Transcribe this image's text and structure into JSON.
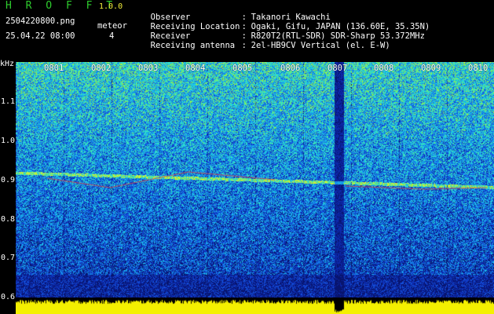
{
  "header": {
    "app_title": "H R O F F T",
    "version": "1.0.0",
    "file_name": "2504220800.png",
    "date_time": "25.04.22 08:00",
    "meteor_label": "meteor",
    "meteor_count": "4"
  },
  "info": [
    {
      "label": "Observer",
      "value": "Takanori Kawachi"
    },
    {
      "label": "Receiving Location",
      "value": "Ogaki, Gifu, JAPAN (136.60E, 35.35N)"
    },
    {
      "label": "Receiver",
      "value": "R820T2(RTL-SDR) SDR-Sharp 53.372MHz"
    },
    {
      "label": "Receiving antenna",
      "value": "2el-HB9CV Vertical (el. E-W)"
    }
  ],
  "axis": {
    "unit": "kHz",
    "freq_labels": [
      "1.1",
      "1.0",
      "0.9",
      "0.8",
      "0.7",
      "0.6"
    ],
    "time_labels": [
      "0801",
      "0802",
      "0803",
      "0804",
      "0805",
      "0806",
      "0807",
      "0808",
      "0809",
      "0810"
    ]
  },
  "colors": {
    "background": "#000000",
    "title_green": "#2ecc2e",
    "version_yellow": "#f4ef3a",
    "amplitude_yellow": "#f4f000",
    "spectrogram_base": "#0a1e78"
  }
}
